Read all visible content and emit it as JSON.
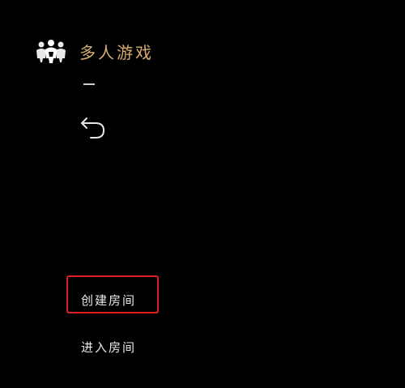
{
  "header": {
    "icon": "multiplayer-people-icon",
    "title": "多人游戏"
  },
  "navigation": {
    "back_icon": "back-arrow-icon"
  },
  "menu": {
    "items": [
      {
        "label": "创建房间",
        "highlighted": true
      },
      {
        "label": "进入房间",
        "highlighted": false
      }
    ]
  },
  "colors": {
    "background": "#000000",
    "title": "#d7ad72",
    "text": "#e9e9e9",
    "highlight": "#e02020"
  }
}
